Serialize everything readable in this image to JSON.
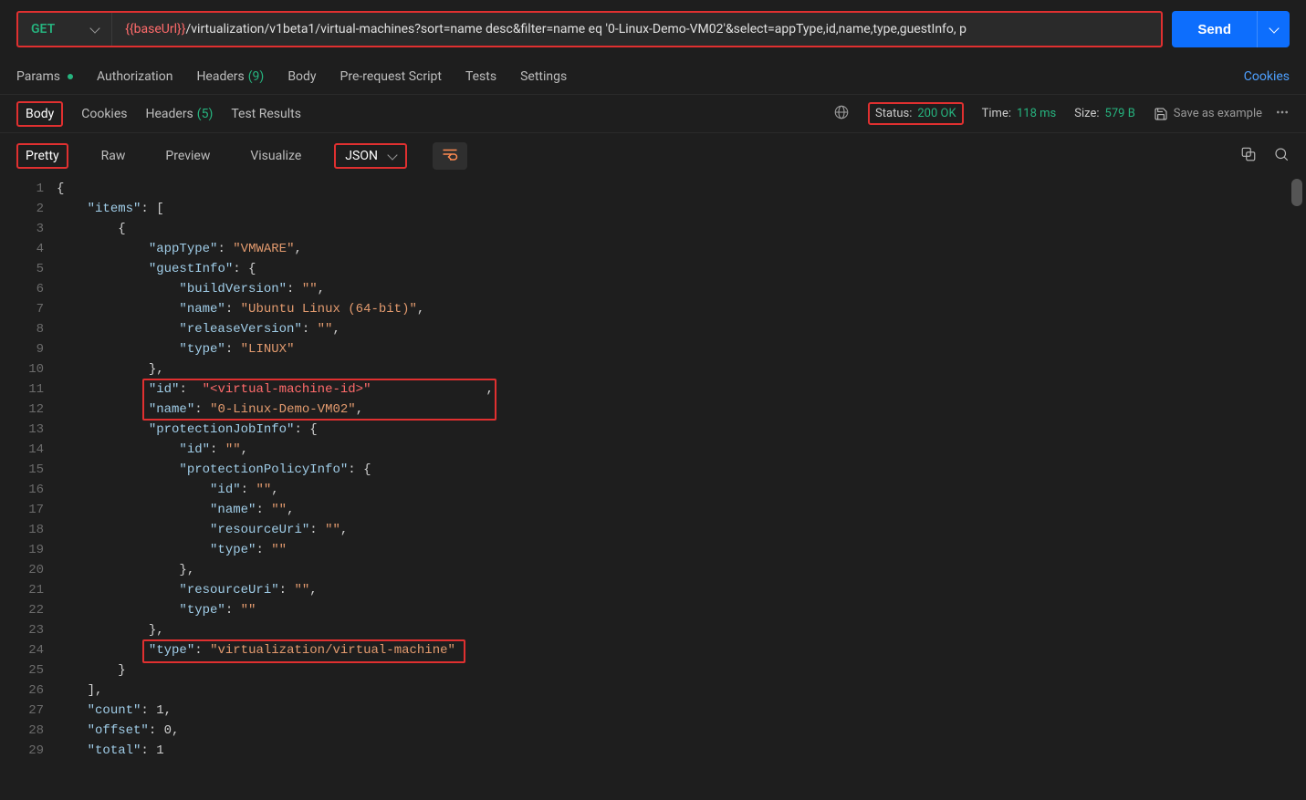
{
  "request": {
    "method": "GET",
    "url_variable": "{{baseUrl}}",
    "url_path": "/virtualization/v1beta1/virtual-machines?sort=name desc&filter=name eq '0-Linux-Demo-VM02'&select=appType,id,name,type,guestInfo, p",
    "send_label": "Send"
  },
  "main_tabs": {
    "params": "Params",
    "authorization": "Authorization",
    "headers": "Headers",
    "headers_count": "(9)",
    "body": "Body",
    "prerequest": "Pre-request Script",
    "tests": "Tests",
    "settings": "Settings",
    "cookies": "Cookies"
  },
  "response_tabs": {
    "body": "Body",
    "cookies": "Cookies",
    "headers": "Headers",
    "headers_count": "(5)",
    "test_results": "Test Results"
  },
  "status": {
    "status_label": "Status:",
    "status_value": "200 OK",
    "time_label": "Time:",
    "time_value": "118 ms",
    "size_label": "Size:",
    "size_value": "579 B",
    "save_example": "Save as example"
  },
  "format_tabs": {
    "pretty": "Pretty",
    "raw": "Raw",
    "preview": "Preview",
    "visualize": "Visualize",
    "json": "JSON"
  },
  "code_lines": [
    {
      "n": 1,
      "indent": 0,
      "tokens": [
        {
          "t": "punc",
          "v": "{"
        }
      ]
    },
    {
      "n": 2,
      "indent": 1,
      "tokens": [
        {
          "t": "key",
          "v": "\"items\""
        },
        {
          "t": "punc",
          "v": ": ["
        }
      ]
    },
    {
      "n": 3,
      "indent": 2,
      "tokens": [
        {
          "t": "punc",
          "v": "{"
        }
      ]
    },
    {
      "n": 4,
      "indent": 3,
      "tokens": [
        {
          "t": "key",
          "v": "\"appType\""
        },
        {
          "t": "punc",
          "v": ": "
        },
        {
          "t": "str",
          "v": "\"VMWARE\""
        },
        {
          "t": "punc",
          "v": ","
        }
      ]
    },
    {
      "n": 5,
      "indent": 3,
      "tokens": [
        {
          "t": "key",
          "v": "\"guestInfo\""
        },
        {
          "t": "punc",
          "v": ": {"
        }
      ]
    },
    {
      "n": 6,
      "indent": 4,
      "tokens": [
        {
          "t": "key",
          "v": "\"buildVersion\""
        },
        {
          "t": "punc",
          "v": ": "
        },
        {
          "t": "str",
          "v": "\"\""
        },
        {
          "t": "punc",
          "v": ","
        }
      ]
    },
    {
      "n": 7,
      "indent": 4,
      "tokens": [
        {
          "t": "key",
          "v": "\"name\""
        },
        {
          "t": "punc",
          "v": ": "
        },
        {
          "t": "str",
          "v": "\"Ubuntu Linux (64-bit)\""
        },
        {
          "t": "punc",
          "v": ","
        }
      ]
    },
    {
      "n": 8,
      "indent": 4,
      "tokens": [
        {
          "t": "key",
          "v": "\"releaseVersion\""
        },
        {
          "t": "punc",
          "v": ": "
        },
        {
          "t": "str",
          "v": "\"\""
        },
        {
          "t": "punc",
          "v": ","
        }
      ]
    },
    {
      "n": 9,
      "indent": 4,
      "tokens": [
        {
          "t": "key",
          "v": "\"type\""
        },
        {
          "t": "punc",
          "v": ": "
        },
        {
          "t": "str",
          "v": "\"LINUX\""
        }
      ]
    },
    {
      "n": 10,
      "indent": 3,
      "tokens": [
        {
          "t": "punc",
          "v": "},"
        }
      ]
    },
    {
      "n": 11,
      "indent": 3,
      "tokens": [
        {
          "t": "key",
          "v": "\"id\""
        },
        {
          "t": "punc",
          "v": ":  "
        },
        {
          "t": "red",
          "v": "\"<virtual-machine-id>\""
        },
        {
          "t": "pad",
          "v": "               "
        },
        {
          "t": "punc",
          "v": ","
        }
      ]
    },
    {
      "n": 12,
      "indent": 3,
      "tokens": [
        {
          "t": "key",
          "v": "\"name\""
        },
        {
          "t": "punc",
          "v": ": "
        },
        {
          "t": "str",
          "v": "\"0-Linux-Demo-VM02\""
        },
        {
          "t": "punc",
          "v": ","
        }
      ]
    },
    {
      "n": 13,
      "indent": 3,
      "tokens": [
        {
          "t": "key",
          "v": "\"protectionJobInfo\""
        },
        {
          "t": "punc",
          "v": ": {"
        }
      ]
    },
    {
      "n": 14,
      "indent": 4,
      "tokens": [
        {
          "t": "key",
          "v": "\"id\""
        },
        {
          "t": "punc",
          "v": ": "
        },
        {
          "t": "str",
          "v": "\"\""
        },
        {
          "t": "punc",
          "v": ","
        }
      ]
    },
    {
      "n": 15,
      "indent": 4,
      "tokens": [
        {
          "t": "key",
          "v": "\"protectionPolicyInfo\""
        },
        {
          "t": "punc",
          "v": ": {"
        }
      ]
    },
    {
      "n": 16,
      "indent": 5,
      "tokens": [
        {
          "t": "key",
          "v": "\"id\""
        },
        {
          "t": "punc",
          "v": ": "
        },
        {
          "t": "str",
          "v": "\"\""
        },
        {
          "t": "punc",
          "v": ","
        }
      ]
    },
    {
      "n": 17,
      "indent": 5,
      "tokens": [
        {
          "t": "key",
          "v": "\"name\""
        },
        {
          "t": "punc",
          "v": ": "
        },
        {
          "t": "str",
          "v": "\"\""
        },
        {
          "t": "punc",
          "v": ","
        }
      ]
    },
    {
      "n": 18,
      "indent": 5,
      "tokens": [
        {
          "t": "key",
          "v": "\"resourceUri\""
        },
        {
          "t": "punc",
          "v": ": "
        },
        {
          "t": "str",
          "v": "\"\""
        },
        {
          "t": "punc",
          "v": ","
        }
      ]
    },
    {
      "n": 19,
      "indent": 5,
      "tokens": [
        {
          "t": "key",
          "v": "\"type\""
        },
        {
          "t": "punc",
          "v": ": "
        },
        {
          "t": "str",
          "v": "\"\""
        }
      ]
    },
    {
      "n": 20,
      "indent": 4,
      "tokens": [
        {
          "t": "punc",
          "v": "},"
        }
      ]
    },
    {
      "n": 21,
      "indent": 4,
      "tokens": [
        {
          "t": "key",
          "v": "\"resourceUri\""
        },
        {
          "t": "punc",
          "v": ": "
        },
        {
          "t": "str",
          "v": "\"\""
        },
        {
          "t": "punc",
          "v": ","
        }
      ]
    },
    {
      "n": 22,
      "indent": 4,
      "tokens": [
        {
          "t": "key",
          "v": "\"type\""
        },
        {
          "t": "punc",
          "v": ": "
        },
        {
          "t": "str",
          "v": "\"\""
        }
      ]
    },
    {
      "n": 23,
      "indent": 3,
      "tokens": [
        {
          "t": "punc",
          "v": "},"
        }
      ]
    },
    {
      "n": 24,
      "indent": 3,
      "tokens": [
        {
          "t": "key",
          "v": "\"type\""
        },
        {
          "t": "punc",
          "v": ": "
        },
        {
          "t": "str",
          "v": "\"virtualization/virtual-machine\""
        }
      ]
    },
    {
      "n": 25,
      "indent": 2,
      "tokens": [
        {
          "t": "punc",
          "v": "}"
        }
      ]
    },
    {
      "n": 26,
      "indent": 1,
      "tokens": [
        {
          "t": "punc",
          "v": "],"
        }
      ]
    },
    {
      "n": 27,
      "indent": 1,
      "tokens": [
        {
          "t": "key",
          "v": "\"count\""
        },
        {
          "t": "punc",
          "v": ": 1,"
        }
      ]
    },
    {
      "n": 28,
      "indent": 1,
      "tokens": [
        {
          "t": "key",
          "v": "\"offset\""
        },
        {
          "t": "punc",
          "v": ": 0,"
        }
      ]
    },
    {
      "n": 29,
      "indent": 1,
      "tokens": [
        {
          "t": "key",
          "v": "\"total\""
        },
        {
          "t": "punc",
          "v": ": 1"
        }
      ]
    }
  ]
}
